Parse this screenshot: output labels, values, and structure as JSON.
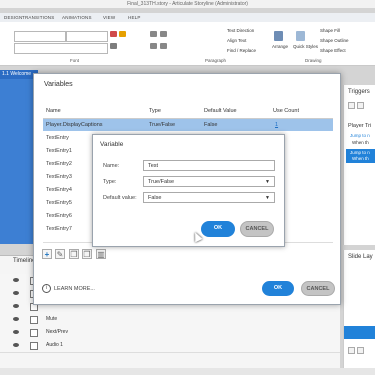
{
  "window": {
    "title": "Final_313TH.story - Articulate Storyline (Administrator)"
  },
  "ribbon": {
    "tabs": [
      "DESIGN",
      "TRANSITIONS",
      "ANIMATIONS",
      "VIEW",
      "HELP"
    ],
    "groups": {
      "font": "Font",
      "paragraph": "Paragraph",
      "drawing": "Drawing"
    },
    "items": {
      "text_direction": "Text Direction",
      "align_text": "Align Text",
      "find_replace": "Find / Replace",
      "arrange": "Arrange",
      "quick_styles": "Quick Styles",
      "shape_fill": "Shape Fill",
      "shape_outline": "Shape Outline",
      "shape_effect": "Shape Effect"
    }
  },
  "workspace": {
    "tab_label": "1.1 Welcome"
  },
  "timeline": {
    "title": "Timeline",
    "rows": [
      "Mute",
      "Next/Prev",
      "Audio 1"
    ]
  },
  "triggers": {
    "title": "Triggers",
    "player_triggers": "Player Tri",
    "jump_to": "Jump to n",
    "when_the": "When th"
  },
  "slide_layers": {
    "title": "Slide Lay"
  },
  "variables_dialog": {
    "title": "Variables",
    "columns": {
      "name": "Name",
      "type": "Type",
      "default_value": "Default Value",
      "use_count": "Use Count"
    },
    "rows": [
      {
        "name": "Player.DisplayCaptions",
        "type": "True/False",
        "default": "False",
        "count": "1"
      },
      {
        "name": "TextEntry",
        "type": "",
        "default": "",
        "count": ""
      },
      {
        "name": "TextEntry1",
        "type": "",
        "default": "",
        "count": ""
      },
      {
        "name": "TextEntry2",
        "type": "",
        "default": "",
        "count": ""
      },
      {
        "name": "TextEntry3",
        "type": "",
        "default": "",
        "count": ""
      },
      {
        "name": "TextEntry4",
        "type": "",
        "default": "",
        "count": ""
      },
      {
        "name": "TextEntry5",
        "type": "",
        "default": "",
        "count": ""
      },
      {
        "name": "TextEntry6",
        "type": "",
        "default": "",
        "count": ""
      },
      {
        "name": "TextEntry7",
        "type": "",
        "default": "",
        "count": ""
      }
    ],
    "learn_more": "LEARN MORE...",
    "ok": "OK",
    "cancel": "CANCEL"
  },
  "variable_dialog": {
    "title": "Variable",
    "name_label": "Name:",
    "name_value": "Test",
    "type_label": "Type:",
    "type_value": "True/False",
    "default_label": "Default value:",
    "default_value": "False",
    "ok": "OK",
    "cancel": "CANCEL"
  },
  "colors": {
    "accent": "#2182d9",
    "selected_row": "#9ec3ea",
    "canvas": "#3d7fd3"
  }
}
